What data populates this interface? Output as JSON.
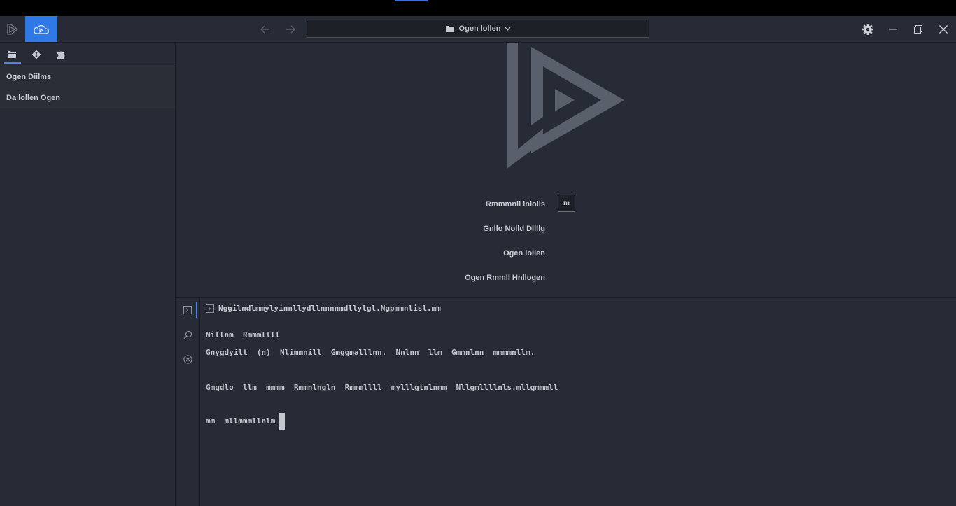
{
  "window": {
    "search_label": "Ogen lollen",
    "search_chevron": "chevron-down-icon"
  },
  "sidebar": {
    "tabs": [
      {
        "icon": "folder-icon"
      },
      {
        "icon": "git-icon"
      },
      {
        "icon": "extensions-icon"
      }
    ],
    "items": [
      {
        "label": "Ogen Diilms"
      },
      {
        "label": "Da lollen Ogen"
      }
    ]
  },
  "main": {
    "form": [
      {
        "label": "Rmmmnll lnlolls"
      },
      {
        "label": "Gnllo Nolld Dllllg"
      },
      {
        "label": "Ogen lollen"
      },
      {
        "label": "Ogen Rmmll Hnllogen"
      }
    ],
    "small_button": "m"
  },
  "terminal": {
    "header_path": "Nggilndlmmylyinnllydllnnnnmdllylgl.Ngpmmnlisl.mm",
    "lines": [
      "Nillnm  Rmmmllll",
      "Gnygdyilt  (n)  Nlimmnill  Gmggmalllnn.  Nnlnn  llm  Gmmnlnn  mmmmnllm.",
      "",
      "Gmgdlo  llm  mmmm  Rmmnlngln  Rmmmllll  mylllgtnlnmm  Nllgmllllnls.mllgmmmll",
      "",
      "mm  mllmmmllnlm"
    ]
  },
  "colors": {
    "accent": "#2f79e6",
    "background": "#272b35",
    "logo": "#5a606b"
  }
}
